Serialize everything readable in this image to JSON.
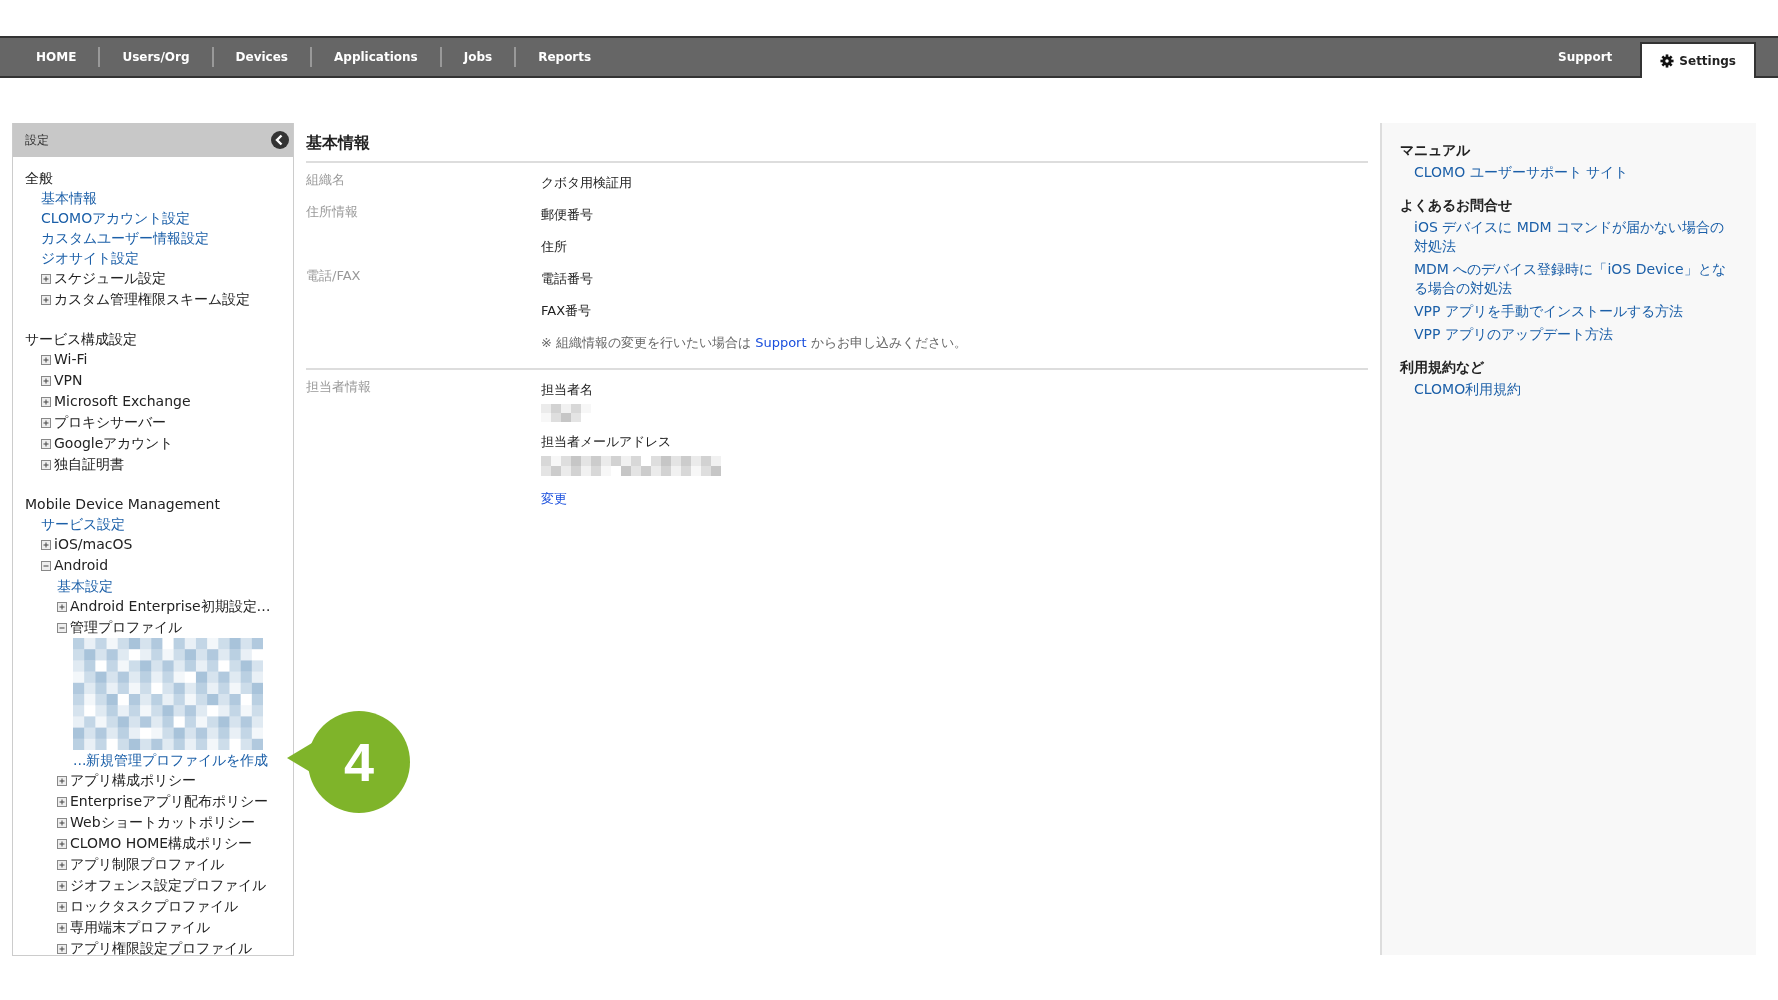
{
  "nav": {
    "items": [
      {
        "label": "HOME",
        "selected": false
      },
      {
        "label": "Users/Org",
        "selected": false
      },
      {
        "label": "Devices",
        "selected": false
      },
      {
        "label": "Applications",
        "selected": false
      },
      {
        "label": "Jobs",
        "selected": false
      },
      {
        "label": "Reports",
        "selected": false
      }
    ],
    "right_items": [
      {
        "label": "Support",
        "selected": false,
        "kind": "plain"
      },
      {
        "label": "Settings",
        "selected": true,
        "kind": "iconic"
      }
    ]
  },
  "sidebar": {
    "title": "設定",
    "sections": [
      {
        "label": "全般",
        "children": [
          {
            "kind": "link",
            "label": "基本情報"
          },
          {
            "kind": "link",
            "label": "CLOMOアカウント設定"
          },
          {
            "kind": "link",
            "label": "カスタムユーザー情報設定"
          },
          {
            "kind": "link",
            "label": "ジオサイト設定"
          },
          {
            "kind": "node",
            "label": "スケジュール設定",
            "expanded": false
          },
          {
            "kind": "node",
            "label": "カスタム管理権限スキーム設定",
            "expanded": false
          }
        ]
      },
      {
        "label": "サービス構成設定",
        "children": [
          {
            "kind": "node",
            "label": "Wi-Fi",
            "expanded": false
          },
          {
            "kind": "node",
            "label": "VPN",
            "expanded": false
          },
          {
            "kind": "node",
            "label": "Microsoft Exchange",
            "expanded": false
          },
          {
            "kind": "node",
            "label": "プロキシサーバー",
            "expanded": false
          },
          {
            "kind": "node",
            "label": "Googleアカウント",
            "expanded": false
          },
          {
            "kind": "node",
            "label": "独自証明書",
            "expanded": false
          }
        ]
      },
      {
        "label": "Mobile Device Management",
        "children": [
          {
            "kind": "link",
            "label": "サービス設定"
          },
          {
            "kind": "node",
            "label": "iOS/macOS",
            "expanded": false
          },
          {
            "kind": "node",
            "label": "Android",
            "expanded": true,
            "children": [
              {
                "kind": "link",
                "label": "基本設定"
              },
              {
                "kind": "node",
                "label": "Android Enterprise初期設定…",
                "expanded": false
              },
              {
                "kind": "node",
                "label": "管理プロファイル",
                "expanded": true,
                "children": [
                  {
                    "kind": "redacted"
                  },
                  {
                    "kind": "link",
                    "label": "...新規管理プロファイルを作成",
                    "callout": "4"
                  }
                ]
              },
              {
                "kind": "node",
                "label": "アプリ構成ポリシー",
                "expanded": false
              },
              {
                "kind": "node",
                "label": "Enterpriseアプリ配布ポリシー",
                "expanded": false
              },
              {
                "kind": "node",
                "label": "Webショートカットポリシー",
                "expanded": false
              },
              {
                "kind": "node",
                "label": "CLOMO HOME構成ポリシー",
                "expanded": false
              },
              {
                "kind": "node",
                "label": "アプリ制限プロファイル",
                "expanded": false
              },
              {
                "kind": "node",
                "label": "ジオフェンス設定プロファイル",
                "expanded": false
              },
              {
                "kind": "node",
                "label": "ロックタスクプロファイル",
                "expanded": false
              },
              {
                "kind": "node",
                "label": "専用端末プロファイル",
                "expanded": false
              },
              {
                "kind": "node",
                "label": "アプリ権限設定プロファイル",
                "expanded": false
              }
            ]
          }
        ]
      }
    ]
  },
  "main": {
    "title": "基本情報",
    "sections": [
      {
        "groups": [
          {
            "label": "組織名",
            "values": [
              {
                "kind": "text",
                "text": "クボタ用検証用"
              }
            ]
          },
          {
            "label": "住所情報",
            "values": [
              {
                "kind": "text",
                "text": "郵便番号"
              },
              {
                "kind": "text",
                "text": "住所"
              }
            ]
          },
          {
            "label": "電話/FAX",
            "values": [
              {
                "kind": "text",
                "text": "電話番号"
              },
              {
                "kind": "text",
                "text": "FAX番号"
              },
              {
                "kind": "note",
                "before": "※ 組織情報の変更を行いたい場合は ",
                "link": "Support",
                "after": " からお申し込みください。"
              }
            ]
          }
        ]
      },
      {
        "groups": [
          {
            "label": "担当者情報",
            "values": [
              {
                "kind": "text",
                "text": "担当者名"
              },
              {
                "kind": "redacted"
              },
              {
                "kind": "text",
                "text": "担当者メールアドレス"
              },
              {
                "kind": "redacted"
              },
              {
                "kind": "link",
                "text": "変更"
              }
            ]
          }
        ]
      }
    ]
  },
  "help": {
    "sections": [
      {
        "title": "マニュアル",
        "links": [
          "CLOMO ユーザーサポート サイト"
        ]
      },
      {
        "title": "よくあるお問合せ",
        "links": [
          "iOS デバイスに MDM コマンドが届かない場合の対処法",
          "MDM へのデバイス登録時に「iOS Device」となる場合の対処法",
          "VPP アプリを手動でインストールする方法",
          "VPP アプリのアップデート方法"
        ]
      },
      {
        "title": "利用規約など",
        "links": [
          "CLOMO利用規約"
        ]
      }
    ]
  }
}
